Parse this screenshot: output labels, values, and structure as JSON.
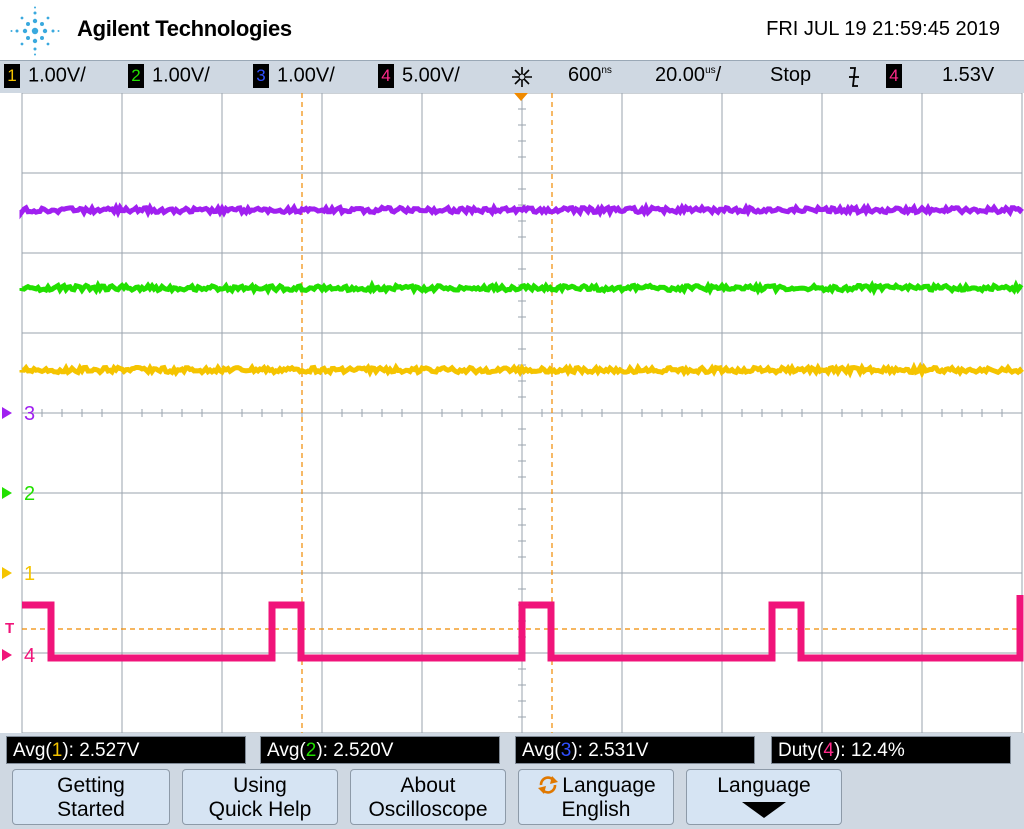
{
  "header": {
    "brand": "Agilent Technologies",
    "datetime": "FRI JUL 19 21:59:45 2019"
  },
  "status": {
    "ch1_num": "1",
    "ch1_scale": "1.00V/",
    "ch2_num": "2",
    "ch2_scale": "1.00V/",
    "ch3_num": "3",
    "ch3_scale": "1.00V/",
    "ch4_num": "4",
    "ch4_scale": "5.00V/",
    "delay": "600",
    "delay_unit": "ns",
    "timebase": "20.00",
    "timebase_unit": "us",
    "timebase_suffix": "/",
    "run_state": "Stop",
    "trigger_source": "4",
    "trigger_level": "1.53V"
  },
  "markers": {
    "ch3": "3",
    "ch2": "2",
    "ch1": "1",
    "trig": "T",
    "ch4": "4"
  },
  "measurements": [
    {
      "prefix": "Avg(",
      "ch": "1",
      "suffix": "): ",
      "value": "2.527V",
      "color": "#f5c400"
    },
    {
      "prefix": "Avg(",
      "ch": "2",
      "suffix": "): ",
      "value": "2.520V",
      "color": "#22e000"
    },
    {
      "prefix": "Avg(",
      "ch": "3",
      "suffix": "): ",
      "value": "2.531V",
      "color": "#3050ff"
    },
    {
      "prefix": "Duty(",
      "ch": "4",
      "suffix": "): ",
      "value": "12.4%",
      "color": "#ff2a8a"
    }
  ],
  "softkeys": {
    "k1_l1": "Getting",
    "k1_l2": "Started",
    "k2_l1": "Using",
    "k2_l2": "Quick Help",
    "k3_l1": "About",
    "k3_l2": "Oscilloscope",
    "k4_l1": "Language",
    "k4_l2": "English",
    "k5_l1": "Language"
  },
  "colors": {
    "ch1": "#f5c400",
    "ch2": "#22e000",
    "ch3": "#a020f0",
    "ch4": "#f0147a",
    "cursor": "#f08a00",
    "grid": "#9aa3ad"
  },
  "icons": [
    "agilent-spark-logo",
    "acquisition-spark-icon",
    "falling-edge-trigger-icon",
    "ground-marker-icon",
    "rotate-arrows-icon",
    "down-arrow-icon"
  ]
}
